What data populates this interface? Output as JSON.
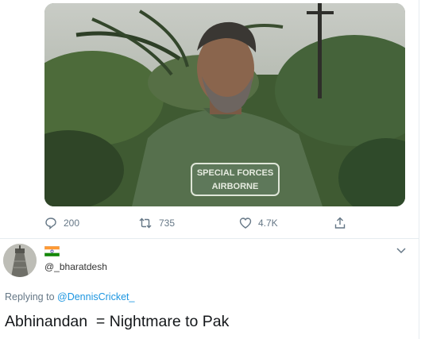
{
  "tweet": {
    "media": {
      "shirt_text_line1": "SPECIAL FORCES",
      "shirt_text_line2": "AIRBORNE"
    },
    "actions": {
      "replies": "200",
      "retweets": "735",
      "likes": "4.7K"
    }
  },
  "reply": {
    "flag_icon": "india-flag-icon",
    "handle": "@_bharatdesh",
    "replying_prefix": "Replying to ",
    "replying_to": "@DennisCricket_",
    "text": "Abhinandan  = Nightmare to Pak"
  },
  "colors": {
    "muted": "#657786",
    "link": "#1b95e0",
    "text": "#14171a",
    "divider": "#e6ecf0"
  }
}
